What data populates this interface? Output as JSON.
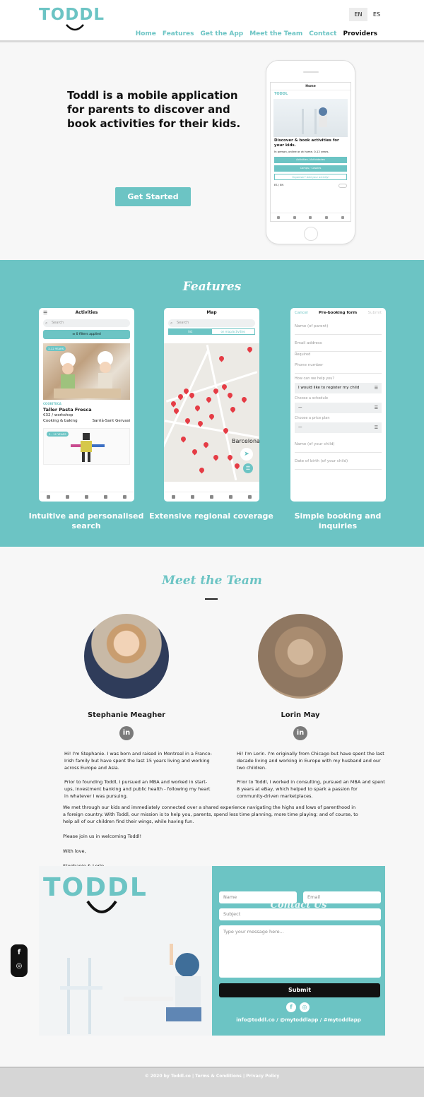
{
  "header": {
    "logo": "TODDL",
    "languages": [
      "EN",
      "ES"
    ],
    "active_language": "EN",
    "nav": [
      "Home",
      "Features",
      "Get the App",
      "Meet the Team",
      "Contact",
      "Providers"
    ]
  },
  "hero": {
    "title": "Toddl is a mobile application for parents to discover and book activities for their kids.",
    "cta": "Get Started",
    "phone": {
      "header": "Home",
      "logo": "TODDL",
      "headline": "Discover & book activities for your kids.",
      "sub": "In person, online or at home. 0-12 years.",
      "buttons": [
        "Activities / Actividades",
        "Camps / Casales"
      ],
      "outline_button": "Organiser? Add your activity!",
      "lang_toggle": "ES / EN"
    }
  },
  "features": {
    "title": "Features",
    "activities": {
      "header": "Activities",
      "search": "Search",
      "filter": "0 filters applied",
      "badge": "3-12 YEARS",
      "category": "COOKITECA",
      "name": "Taller Pasta Fresca",
      "price": "€32 / workshop",
      "type": "Cooking & baking",
      "location": "Sarrià-Sant Gervasi",
      "badge2": "3 - 12 YEARS"
    },
    "map": {
      "header": "Map",
      "search": "Search",
      "segments": [
        "list",
        "on map/activities"
      ],
      "city": "Barcelona"
    },
    "form": {
      "cancel": "Cancel",
      "title": "Pre-booking form",
      "submit": "Submit",
      "fields": [
        "Name (of parent)",
        "Email address"
      ],
      "required": "Required",
      "phone": "Phone number",
      "help_label": "How can we help you?",
      "help_value": "I would like to register my child",
      "schedule_label": "Choose a schedule",
      "schedule_value": "—",
      "price_label": "Choose a price plan",
      "price_value": "—",
      "child_name": "Name (of your child)",
      "child_dob": "Date of birth (of your child)"
    },
    "captions": [
      "Intuitive and personalised search",
      "Extensive regional coverage",
      "Simple booking and inquiries"
    ]
  },
  "team": {
    "title": "Meet the Team",
    "members": [
      {
        "name": "Stephanie Meagher",
        "bio": [
          "Hi! I'm Stephanie. I was born and raised in Montreal in a Franco-Irish family but have spent the last 15 years living and working across Europe and Asia.",
          "Prior to founding Toddl, I pursued an MBA and worked in start-ups, investment banking and public health - following my heart in whatever I was pursuing."
        ]
      },
      {
        "name": "Lorin May",
        "bio": [
          "Hi! I'm Lorin. I'm originally from Chicago but have spent the last decade living and working in Europe with my husband and our two children.",
          "Prior to Toddl, I worked in consulting, pursued an MBA and spent 8 years at eBay, which helped to spark a passion for community-driven marketplaces."
        ]
      }
    ],
    "letter": [
      "We met through our kids and immediately connected over a shared experience navigating the highs and lows of parenthood in a foreign country. With Toddl, our mission is to help you, parents, spend less time planning, more time playing; and of course, to help all of our children find their wings, while having fun.",
      "Please join us in welcoming Toddl!",
      "With love,",
      "Stephanie & Lorin"
    ],
    "linkedin": "in"
  },
  "contact": {
    "logo": "TODDL",
    "title": "Contact Us",
    "name_placeholder": "Name",
    "email_placeholder": "Email",
    "subject_placeholder": "Subject",
    "message_placeholder": "Type your message here...",
    "submit": "Submit",
    "social": [
      "f",
      "◎"
    ],
    "email_line": "info@toddl.co / @mytoddlapp / #mytoddlapp"
  },
  "side_social": [
    "f",
    "◎"
  ],
  "footer": {
    "text": "© 2020 by Toddl.co | Terms & Conditions | Privacy Policy"
  },
  "colors": {
    "accent": "#6cc4c4",
    "dark": "#111111",
    "pin": "#e53c45"
  }
}
